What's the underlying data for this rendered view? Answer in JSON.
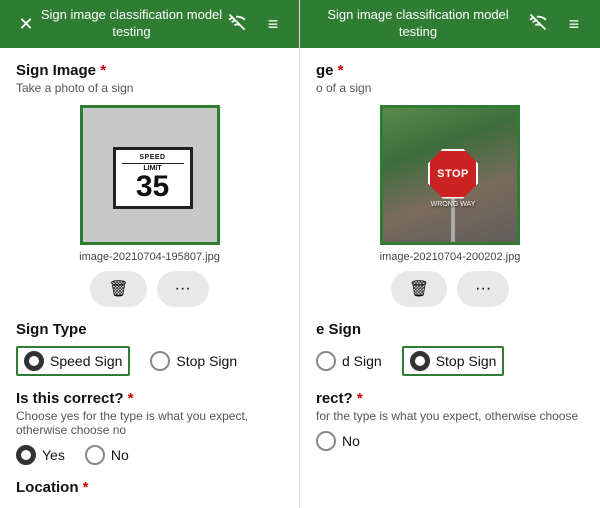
{
  "left_screen": {
    "header": {
      "title": "Sign image classification model testing",
      "close_label": "✕",
      "wifi_icon": "wifi-off",
      "menu_icon": "≡"
    },
    "sign_image_section": {
      "label": "Sign Image",
      "required": "*",
      "sublabel": "Take a photo of a sign",
      "filename": "image-20210704-195807.jpg",
      "delete_btn": "🗑",
      "more_btn": "···"
    },
    "sign_type_section": {
      "label": "Sign Type",
      "options": [
        {
          "value": "speed",
          "label": "Speed Sign",
          "selected": true
        },
        {
          "value": "stop",
          "label": "Stop Sign",
          "selected": false
        }
      ]
    },
    "correct_section": {
      "label": "Is this correct?",
      "required": "*",
      "desc": "Choose yes for the type is what you expect, otherwise choose no",
      "options": [
        {
          "value": "yes",
          "label": "Yes",
          "selected": true
        },
        {
          "value": "no",
          "label": "No",
          "selected": false
        }
      ]
    },
    "location_section": {
      "label": "Location",
      "required": "*"
    }
  },
  "right_screen": {
    "header": {
      "title": "Sign image classification model testing",
      "wifi_icon": "wifi-off",
      "menu_icon": "≡"
    },
    "sign_image_section": {
      "label": "ge",
      "required": "*",
      "sublabel": "o of a sign",
      "filename": "image-20210704-200202.jpg",
      "delete_btn": "🗑",
      "more_btn": "···"
    },
    "sign_type_section": {
      "label": "e Sign",
      "options": [
        {
          "value": "speed",
          "label": "d Sign",
          "selected": false
        },
        {
          "value": "stop",
          "label": "Stop Sign",
          "selected": true
        }
      ]
    },
    "correct_section": {
      "label": "rect?",
      "required": "*",
      "desc": "for the type is what you expect, otherwise choose",
      "options": [
        {
          "value": "no",
          "label": "No",
          "selected": false
        }
      ]
    }
  },
  "colors": {
    "header_bg": "#2e7d32",
    "highlight_border": "#2e7d32",
    "radio_selected": "#333",
    "text_primary": "#111",
    "text_secondary": "#555"
  }
}
